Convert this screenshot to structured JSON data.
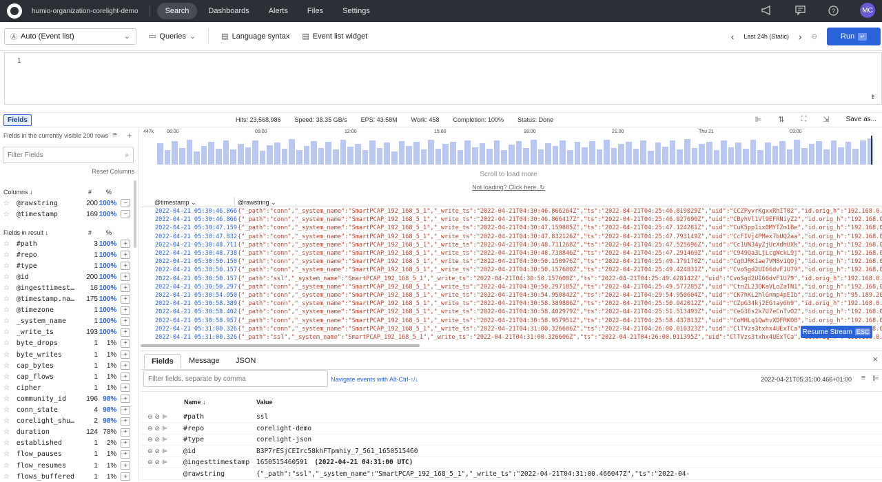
{
  "topnav": {
    "org": "humio-organization-corelight-demo",
    "items": [
      {
        "label": "Search"
      },
      {
        "label": "Dashboards"
      },
      {
        "label": "Alerts"
      },
      {
        "label": "Files"
      },
      {
        "label": "Settings"
      }
    ],
    "avatar": "MC"
  },
  "toolbar": {
    "mode": "Auto (Event list)",
    "queries": "Queries",
    "language_syntax": "Language syntax",
    "event_list_widget": "Event list widget",
    "timerange": "Last 24h (Static)",
    "run": "Run",
    "run_key": "↵"
  },
  "editor": {
    "line": "1"
  },
  "statusbar": {
    "fields_btn": "Fields",
    "hits": "Hits: 23,568,986",
    "speed": "Speed: 38.35 GB/s",
    "eps": "EPS: 43.58M",
    "work": "Work: 458",
    "completion": "Completion: 100%",
    "status": "Status: Done",
    "save_as": "Save as..."
  },
  "sidebar": {
    "heading": "Fields in the currently visible 200 rows",
    "filter_placeholder": "Filter Fields",
    "reset": "Reset Columns",
    "columns_label": "Columns ↓",
    "hash": "#",
    "pct": "%",
    "columns": [
      {
        "name": "@rawstring",
        "count": "200",
        "pct": "100%",
        "btn": "−"
      },
      {
        "name": "@timestamp",
        "count": "169",
        "pct": "100%",
        "btn": "−"
      }
    ],
    "result_label": "Fields in result ↓",
    "fields": [
      {
        "name": "#path",
        "count": "3",
        "pct": "100%"
      },
      {
        "name": "#repo",
        "count": "1",
        "pct": "100%"
      },
      {
        "name": "#type",
        "count": "1",
        "pct": "100%"
      },
      {
        "name": "@id",
        "count": "200",
        "pct": "100%"
      },
      {
        "name": "@ingesttimest…",
        "count": "16",
        "pct": "100%"
      },
      {
        "name": "@timestamp.na…",
        "count": "175",
        "pct": "100%"
      },
      {
        "name": "@timezone",
        "count": "1",
        "pct": "100%"
      },
      {
        "name": "_system_name",
        "count": "1",
        "pct": "100%"
      },
      {
        "name": "_write_ts",
        "count": "193",
        "pct": "100%"
      },
      {
        "name": "byte_drops",
        "count": "1",
        "pct": "1%"
      },
      {
        "name": "byte_writes",
        "count": "1",
        "pct": "1%"
      },
      {
        "name": "cap_bytes",
        "count": "1",
        "pct": "1%"
      },
      {
        "name": "cap_flows",
        "count": "1",
        "pct": "1%"
      },
      {
        "name": "cipher",
        "count": "1",
        "pct": "1%"
      },
      {
        "name": "community_id",
        "count": "196",
        "pct": "98%"
      },
      {
        "name": "conn_state",
        "count": "4",
        "pct": "98%"
      },
      {
        "name": "corelight_shu…",
        "count": "2",
        "pct": "98%"
      },
      {
        "name": "duration",
        "count": "124",
        "pct": "78%"
      },
      {
        "name": "established",
        "count": "1",
        "pct": "2%"
      },
      {
        "name": "flow_pauses",
        "count": "1",
        "pct": "1%"
      },
      {
        "name": "flow_resumes",
        "count": "1",
        "pct": "1%"
      },
      {
        "name": "flows_buffered",
        "count": "1",
        "pct": "1%"
      }
    ]
  },
  "histogram": {
    "ymax_label": "447k",
    "ticks": [
      "06:00",
      "09:00",
      "12:00",
      "15:00",
      "18:00",
      "21:00",
      "Thu 21",
      "03:00"
    ],
    "bars": [
      0.82,
      0.55,
      0.9,
      0.62,
      0.95,
      0.5,
      0.7,
      0.88,
      0.6,
      0.93,
      0.57,
      0.8,
      0.66,
      0.91,
      0.52,
      0.75,
      0.85,
      0.6,
      0.97,
      0.55,
      0.72,
      0.9,
      0.63,
      0.86,
      0.58,
      0.94,
      0.68,
      0.8,
      0.56,
      0.92,
      0.64,
      0.83,
      0.5,
      0.9,
      0.7,
      0.87,
      0.59,
      0.95,
      0.61,
      0.78,
      0.88,
      0.54,
      0.91,
      0.67,
      0.82,
      0.6,
      0.93,
      0.56,
      0.76,
      0.89,
      0.63,
      0.96,
      0.58,
      0.81,
      0.7,
      0.92,
      0.55,
      0.86,
      0.65,
      0.9,
      0.57,
      0.94,
      0.62,
      0.79,
      0.88,
      0.6,
      0.93,
      0.53,
      0.84,
      0.69,
      0.91,
      0.58,
      0.97,
      0.64,
      0.8,
      0.87,
      0.56,
      0.92,
      0.66,
      0.85,
      0.6,
      0.95,
      0.55,
      0.83,
      0.71,
      0.9,
      0.59,
      0.94,
      0.63,
      0.78,
      0.89,
      0.57,
      0.91,
      0.67,
      0.86,
      0.6,
      0.93,
      0.99
    ]
  },
  "events": {
    "scroll_msg": "Scroll to load more",
    "not_loading": "Not loading? Click here.",
    "col_ts": "@timestamp",
    "col_raw": "@rawstring",
    "rows": [
      {
        "ts": "2022-04-21 05:30:46.866",
        "raw": "{\"_path\":\"conn\",\"_system_name\":\"SmartPCAP_192_168_5_1\",\"_write_ts\":\"2022-04-21T04:30:46.866264Z\",\"ts\":\"2022-04-21T04:25:46.819029Z\",\"uid\":\"CCZPyvrKgxxRhIT02\",\"id.orig_h\":\"192.168.0.51\",\"id.orig"
      },
      {
        "ts": "2022-04-21 05:30:46.866",
        "raw": "{\"_path\":\"conn\",\"_system_name\":\"SmartPCAP_192_168_5_1\",\"_write_ts\":\"2022-04-21T04:30:46.866417Z\",\"ts\":\"2022-04-21T04:25:46.827690Z\",\"uid\":\"CByhVl1Vl9EFRNiyZ2\",\"id.orig_h\":\"192.168.0.51\",\"id.or"
      },
      {
        "ts": "2022-04-21 05:30:47.159",
        "raw": "{\"_path\":\"conn\",\"_system_name\":\"SmartPCAP_192_168_5_1\",\"_write_ts\":\"2022-04-21T04:30:47.159885Z\",\"ts\":\"2022-04-21T04:25:47.124281Z\",\"uid\":\"CuK5pp1ix0MYTZm1Be\",\"id.orig_h\":\"192.168.0.51\",\"id.or"
      },
      {
        "ts": "2022-04-21 05:30:47.832",
        "raw": "{\"_path\":\"conn\",\"_system_name\":\"SmartPCAP_192_168_5_1\",\"_write_ts\":\"2022-04-21T04:30:47.832126Z\",\"ts\":\"2022-04-21T04:25:47.793149Z\",\"uid\":\"CcFIVj4PMex7bUQ2aa\",\"id.orig_h\":\"192.168.0.54\",\"id.or"
      },
      {
        "ts": "2022-04-21 05:30:48.711",
        "raw": "{\"_path\":\"conn\",\"_system_name\":\"SmartPCAP_192_168_5_1\",\"_write_ts\":\"2022-04-21T04:30:48.711268Z\",\"ts\":\"2022-04-21T04:25:47.525696Z\",\"uid\":\"Cc1UN34yZjUcXdhUXk\",\"id.orig_h\":\"192.168.0.51\",\"id.or"
      },
      {
        "ts": "2022-04-21 05:30:48.738",
        "raw": "{\"_path\":\"conn\",\"_system_name\":\"SmartPCAP_192_168_5_1\",\"_write_ts\":\"2022-04-21T04:30:48.738846Z\",\"ts\":\"2022-04-21T04:25:47.291469Z\",\"uid\":\"C949Qa3LjLcgWckL9j\",\"id.orig_h\":\"192.168.0.51\",\"id.or"
      },
      {
        "ts": "2022-04-21 05:30:50.150",
        "raw": "{\"_path\":\"conn\",\"_system_name\":\"SmartPCAP_192_168_5_1\",\"_write_ts\":\"2022-04-21T04:30:50.150976Z\",\"ts\":\"2022-04-21T04:25:49.179170Z\",\"uid\":\"CgOJRK1ae7VM8v1QOj\",\"id.orig_h\":\"192.168.0.51\",\"id.or"
      },
      {
        "ts": "2022-04-21 05:30:50.157",
        "raw": "{\"_path\":\"conn\",\"_system_name\":\"SmartPCAP_192_168_5_1\",\"_write_ts\":\"2022-04-21T04:30:50.157600Z\",\"ts\":\"2022-04-21T04:25:49.424831Z\",\"uid\":\"CvoSgd2UI66dvF1U79\",\"id.orig_h\":\"192.168.0.51\",\"id.or"
      },
      {
        "ts": "2022-04-21 05:30:50.157",
        "raw": "{\"_path\":\"ssl\",\"_system_name\":\"SmartPCAP_192_168_5_1\",\"_write_ts\":\"2022-04-21T04:30:50.157600Z\",\"ts\":\"2022-04-21T04:25:49.428142Z\",\"uid\":\"CvoSgd2UI66dvF1U79\",\"id.orig_h\":\"192.168.0.51\",\"id.orig"
      },
      {
        "ts": "2022-04-21 05:30:50.297",
        "raw": "{\"_path\":\"conn\",\"_system_name\":\"SmartPCAP_192_168_5_1\",\"_write_ts\":\"2022-04-21T04:30:50.297185Z\",\"ts\":\"2022-04-21T04:25:49.577285Z\",\"uid\":\"CtnZL23OKaVLoZaTN1\",\"id.orig_h\":\"192.168.0.51\",\"id.or"
      },
      {
        "ts": "2022-04-21 05:30:54.950",
        "raw": "{\"_path\":\"conn\",\"_system_name\":\"SmartPCAP_192_168_5_1\",\"_write_ts\":\"2022-04-21T04:30:54.950842Z\",\"ts\":\"2022-04-21T04:29:54.950604Z\",\"uid\":\"CK7hKL2hlGnmp4pEIb\",\"id.orig_h\":\"95.189.201.169\",\"id.o"
      },
      {
        "ts": "2022-04-21 05:30:58.389",
        "raw": "{\"_path\":\"conn\",\"_system_name\":\"SmartPCAP_192_168_5_1\",\"_write_ts\":\"2022-04-21T04:30:58.389886Z\",\"ts\":\"2022-04-21T04:25:50.942012Z\",\"uid\":\"CZpG34kj2EGtay6h9\",\"id.orig_h\":\"192.168.0.51\",\"id.ori"
      },
      {
        "ts": "2022-04-21 05:30:58.402",
        "raw": "{\"_path\":\"conn\",\"_system_name\":\"SmartPCAP_192_168_5_1\",\"_write_ts\":\"2022-04-21T04:30:58.402979Z\",\"ts\":\"2022-04-21T04:25:51.513493Z\",\"uid\":\"CeG3Es2k7U7eCnTvO2\",\"id.orig_h\":\"192.168.0.51\",\"id.or"
      },
      {
        "ts": "2022-04-21 05:30:58.957",
        "raw": "{\"_path\":\"conn\",\"_system_name\":\"SmartPCAP_192_168_5_1\",\"_write_ts\":\"2022-04-21T04:30:58.957951Z\",\"ts\":\"2022-04-21T04:25:58.437813Z\",\"uid\":\"CoMHLq1QwhvXDFRKO8\",\"id.orig_h\":\"192.168.0.51\",\"id.or"
      },
      {
        "ts": "2022-04-21 05:31:00.326",
        "raw": "{\"_path\":\"conn\",\"_system_name\":\"SmartPCAP_192_168_5_1\",\"_write_ts\":\"2022-04-21T04:31:00.326606Z\",\"ts\":\"2022-04-21T04:26:00.010323Z\",\"uid\":\"ClTVzs3txhx4UExTCa\",\"id.orig_h\":\"192.168.0.51\",\"id.or"
      },
      {
        "ts": "2022-04-21 05:31:00.326",
        "raw": "{\"_path\":\"ssl\",\"_system_name\":\"SmartPCAP_192_168_5_1\",\"_write_ts\":\"2022-04-21T04:31:00.326606Z\",\"ts\":\"2022-04-21T04:26:00.011395Z\",\"uid\":\"ClTVzs3txhx4UExTCa\",\"id.orig_h\":\"192.168.0.51\",\"id.orig"
      }
    ],
    "resume": "Resume Stream",
    "resume_key": "ESC"
  },
  "details": {
    "tabs": [
      "Fields",
      "Message",
      "JSON"
    ],
    "filter_placeholder": "Filter fields, separate by comma",
    "nav_hint": "Navigate events with Alt-Ctrl-↑/↓",
    "event_time": "2022-04-21T05:31:00.466+01:00",
    "col_name": "Name ↓",
    "col_value": "Value",
    "rows": [
      {
        "name": "#path",
        "value": "ssl",
        "extra": ""
      },
      {
        "name": "#repo",
        "value": "corelight-demo",
        "extra": ""
      },
      {
        "name": "#type",
        "value": "corelight-json",
        "extra": ""
      },
      {
        "name": "@id",
        "value": "B3P7rESjCEIrc58khFTpmhiy_7_561_1650515460",
        "extra": ""
      },
      {
        "name": "@ingesttimestamp",
        "value": "1650515460591",
        "extra": "(2022-04-21 04:31:00 UTC)"
      },
      {
        "name": "@rawstring",
        "value": "{\"_path\":\"ssl\",\"_system_name\":\"SmartPCAP_192_168_5_1\",\"_write_ts\":\"2022-04-21T04:31:00.466047Z\",\"ts\":\"2022-04-",
        "extra": ""
      }
    ]
  }
}
